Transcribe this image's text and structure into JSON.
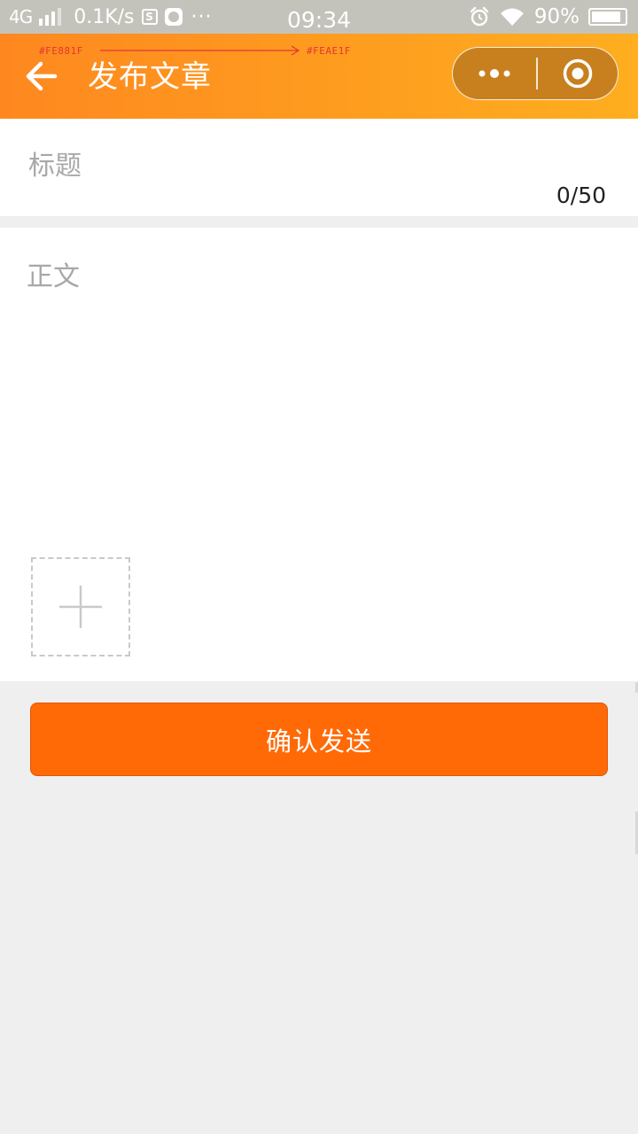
{
  "status_bar": {
    "network": "4G",
    "speed": "0.1K/s",
    "dots": "···",
    "time": "09:34",
    "battery": "90%",
    "battery_level": 0.9,
    "icons": [
      "signal-icon",
      "sim-box-icon",
      "app-notification-icon",
      "alarm-icon",
      "wifi-icon",
      "battery-icon"
    ]
  },
  "nav": {
    "title": "发布文章",
    "gradient_start": "#FE881F",
    "gradient_end": "#FEAE1F",
    "annotation_from": "#FE881F",
    "annotation_to": "#FEAE1F",
    "back_icon": "arrow-left-icon",
    "capsule": {
      "more_icon": "more-dots-icon",
      "close_icon": "target-circle-icon",
      "background": "#C8801F"
    }
  },
  "form": {
    "title_placeholder": "标题",
    "title_value": "",
    "title_counter": "0/50",
    "body_placeholder": "正文",
    "body_value": "",
    "add_image_icon": "plus-icon"
  },
  "actions": {
    "submit_label": "确认发送",
    "submit_color": "#FF6A06"
  },
  "colors": {
    "page_background": "#EFEFEF",
    "placeholder": "#A8A8A8",
    "status_bar": "#C4C3BB"
  }
}
